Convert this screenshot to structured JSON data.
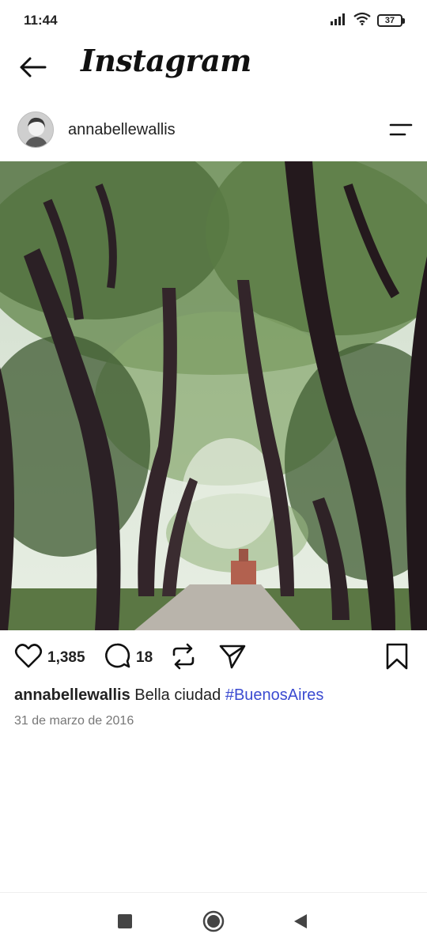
{
  "status_bar": {
    "time": "11:44",
    "battery": "37",
    "icons": [
      "signal-icon",
      "wifi-icon",
      "battery-icon"
    ]
  },
  "header": {
    "logo": "Instagram",
    "back_icon": "back-arrow-icon"
  },
  "post": {
    "username": "annabellewallis",
    "menu_icon": "menu-icon",
    "likes": "1,385",
    "comments": "18",
    "caption_user": "annabellewallis",
    "caption_text": "Bella ciudad",
    "caption_tag": "#BuenosAires",
    "date": "31 de marzo de 2016",
    "tag_color": "#3b4bd1"
  },
  "nav": {
    "icons": [
      "recents-square-icon",
      "home-circle-icon",
      "back-triangle-icon"
    ]
  }
}
